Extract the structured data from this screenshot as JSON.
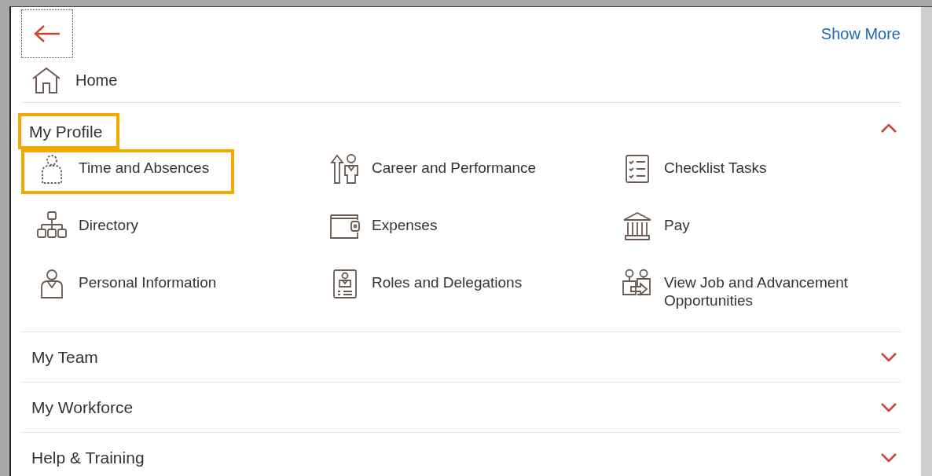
{
  "back_button": {
    "focused": true
  },
  "show_more": "Show More",
  "home": "Home",
  "sections": [
    {
      "title": "My Profile",
      "expanded": true,
      "highlighted": true,
      "items": [
        {
          "label": "Time and Absences",
          "highlighted": true
        },
        {
          "label": "Career and Performance",
          "highlighted": false
        },
        {
          "label": "Checklist Tasks",
          "highlighted": false
        },
        {
          "label": "Directory",
          "highlighted": false
        },
        {
          "label": "Expenses",
          "highlighted": false
        },
        {
          "label": "Pay",
          "highlighted": false
        },
        {
          "label": "Personal Information",
          "highlighted": false
        },
        {
          "label": "Roles and Delegations",
          "highlighted": false
        },
        {
          "label": "View Job and Advancement Opportunities",
          "highlighted": false
        }
      ]
    },
    {
      "title": "My Team",
      "expanded": false,
      "highlighted": false
    },
    {
      "title": "My Workforce",
      "expanded": false,
      "highlighted": false
    },
    {
      "title": "Help & Training",
      "expanded": false,
      "highlighted": false
    }
  ]
}
